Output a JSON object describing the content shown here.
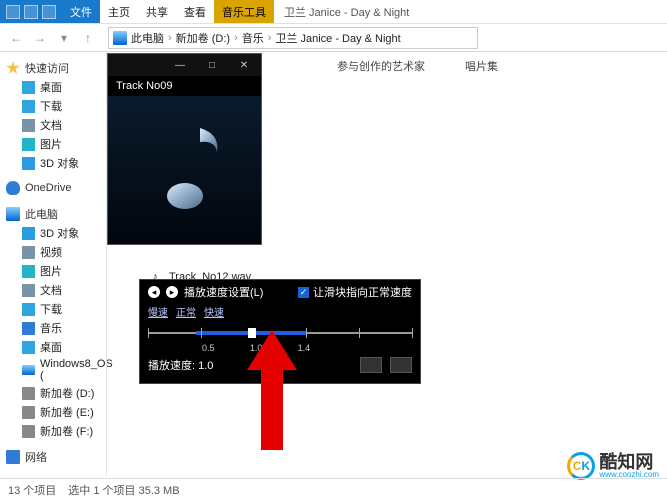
{
  "window": {
    "title": "卫兰 Janice - Day & Night",
    "context_tool": "音乐工具",
    "tabs": {
      "file": "文件",
      "home": "主页",
      "share": "共享",
      "view": "查看"
    }
  },
  "breadcrumb": [
    "此电脑",
    "新加卷 (D:)",
    "音乐",
    "卫兰 Janice - Day & Night"
  ],
  "columns": {
    "artist": "参与创作的艺术家",
    "album": "唱片集"
  },
  "sidebar": {
    "quick": {
      "label": "快速访问",
      "items": [
        "桌面",
        "下载",
        "文档",
        "图片",
        "3D 对象"
      ]
    },
    "onedrive": "OneDrive",
    "thispc": {
      "label": "此电脑",
      "items": [
        "3D 对象",
        "视频",
        "图片",
        "文档",
        "下载",
        "音乐",
        "桌面",
        "Windows8_OS (",
        "新加卷 (D:)",
        "新加卷 (E:)",
        "新加卷 (F:)"
      ]
    },
    "network": "网络"
  },
  "files": {
    "row1": "Track_No12.wav"
  },
  "player": {
    "track": "Track No09"
  },
  "speed": {
    "title": "播放速度设置(L)",
    "checkbox": "让滑块指向正常速度",
    "tabs": [
      "慢速",
      "正常",
      "快速"
    ],
    "labels": [
      "",
      "0.5",
      "1.0",
      "1.4",
      "",
      ""
    ],
    "current": "播放速度: 1.0"
  },
  "status": {
    "count": "13 个项目",
    "sel": "选中 1 个项目 35.3 MB"
  },
  "watermark": {
    "big": "酷知网",
    "small": "www.coozhi.com",
    "logo_k": "K"
  }
}
